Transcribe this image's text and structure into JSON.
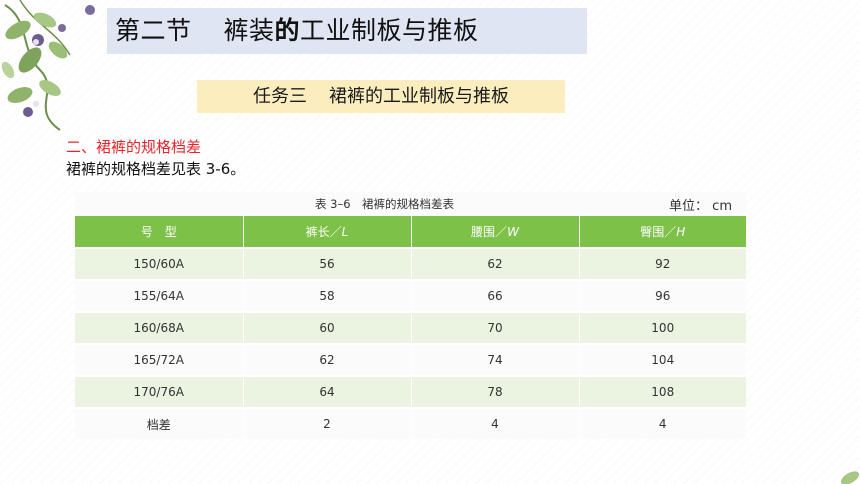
{
  "header": {
    "title_part1": "第二节",
    "title_part2": "裤装",
    "title_part3": "的",
    "title_part4": "工业制板与推板"
  },
  "task": {
    "label": "任务三",
    "title": "裙裤的工业制板与推板"
  },
  "section": {
    "heading": "二、裙裤的规格档差",
    "text": "裙裤的规格档差见表 3-6。"
  },
  "table": {
    "caption": "表 3–6　裙裤的规格档差表",
    "unit": "单位：  cm",
    "headers": [
      {
        "label": "号　型",
        "var": ""
      },
      {
        "label": "裤长／",
        "var": "L"
      },
      {
        "label": "腰围／",
        "var": "W"
      },
      {
        "label": "臀围／",
        "var": "H"
      }
    ],
    "rows": [
      [
        "150/60A",
        "56",
        "62",
        "92"
      ],
      [
        "155/64A",
        "58",
        "66",
        "96"
      ],
      [
        "160/68A",
        "60",
        "70",
        "100"
      ],
      [
        "165/72A",
        "62",
        "74",
        "104"
      ],
      [
        "170/76A",
        "64",
        "78",
        "108"
      ],
      [
        "档差",
        "2",
        "4",
        "4"
      ]
    ]
  },
  "colors": {
    "title_bg": "#dfe5f3",
    "banner_bg": "#fbedbe",
    "heading_red": "#e8242b",
    "table_header_green": "#7dc149",
    "table_alt_row": "#eaf4e0"
  }
}
